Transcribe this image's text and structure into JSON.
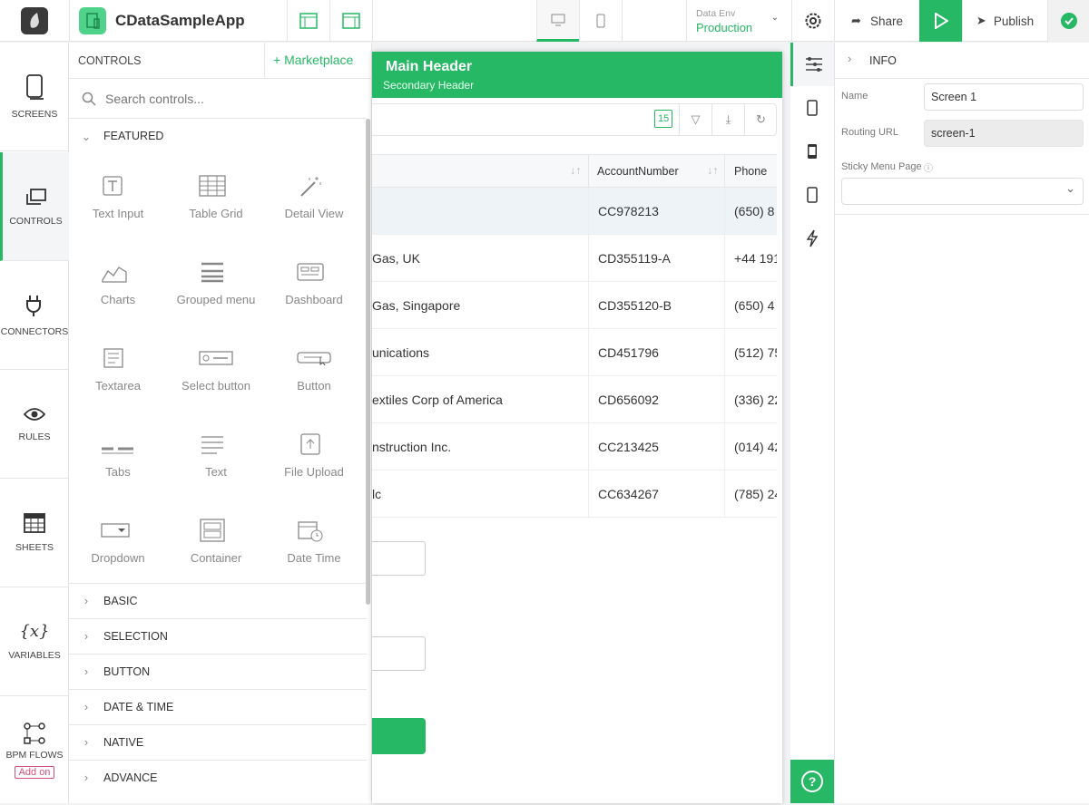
{
  "app": {
    "name": "CDataSampleApp"
  },
  "topbar": {
    "data_env_label": "Data Env",
    "data_env_value": "Production",
    "share": "Share",
    "publish": "Publish"
  },
  "nav": [
    {
      "label": "SCREENS"
    },
    {
      "label": "CONTROLS"
    },
    {
      "label": "CONNECTORS"
    },
    {
      "label": "RULES"
    },
    {
      "label": "SHEETS"
    },
    {
      "label": "VARIABLES"
    },
    {
      "label": "BPM FLOWS",
      "badge": "Add on"
    }
  ],
  "controls": {
    "title": "CONTROLS",
    "marketplace": "+ Marketplace",
    "search_placeholder": "Search controls...",
    "featured": "FEATURED",
    "items": [
      {
        "label": "Text Input"
      },
      {
        "label": "Table Grid"
      },
      {
        "label": "Detail View"
      },
      {
        "label": "Charts"
      },
      {
        "label": "Grouped menu"
      },
      {
        "label": "Dashboard"
      },
      {
        "label": "Textarea"
      },
      {
        "label": "Select button"
      },
      {
        "label": "Button"
      },
      {
        "label": "Tabs"
      },
      {
        "label": "Text"
      },
      {
        "label": "File Upload"
      },
      {
        "label": "Dropdown"
      },
      {
        "label": "Container"
      },
      {
        "label": "Date Time"
      }
    ],
    "categories": [
      "BASIC",
      "SELECTION",
      "BUTTON",
      "DATE & TIME",
      "NATIVE",
      "ADVANCE"
    ]
  },
  "canvas": {
    "main_header": "Main Header",
    "secondary_header": "Secondary Header",
    "count": "15",
    "columns": [
      "AccountNumber",
      "Phone"
    ],
    "rows": [
      [
        "",
        "CC978213",
        "(650) 8"
      ],
      [
        "Gas, UK",
        "CD355119-A",
        "+44 191"
      ],
      [
        "Gas, Singapore",
        "CD355120-B",
        "(650) 4"
      ],
      [
        "unications",
        "CD451796",
        "(512) 75"
      ],
      [
        "extiles Corp of America",
        "CD656092",
        "(336) 22"
      ],
      [
        "nstruction Inc.",
        "CC213425",
        "(014) 42"
      ],
      [
        "lc",
        "CC634267",
        "(785) 24"
      ]
    ]
  },
  "info": {
    "title": "INFO",
    "name_label": "Name",
    "name_value": "Screen 1",
    "routing_label": "Routing URL",
    "routing_value": "screen-1",
    "sticky_label": "Sticky Menu Page"
  },
  "colors": {
    "accent": "#27b865"
  }
}
